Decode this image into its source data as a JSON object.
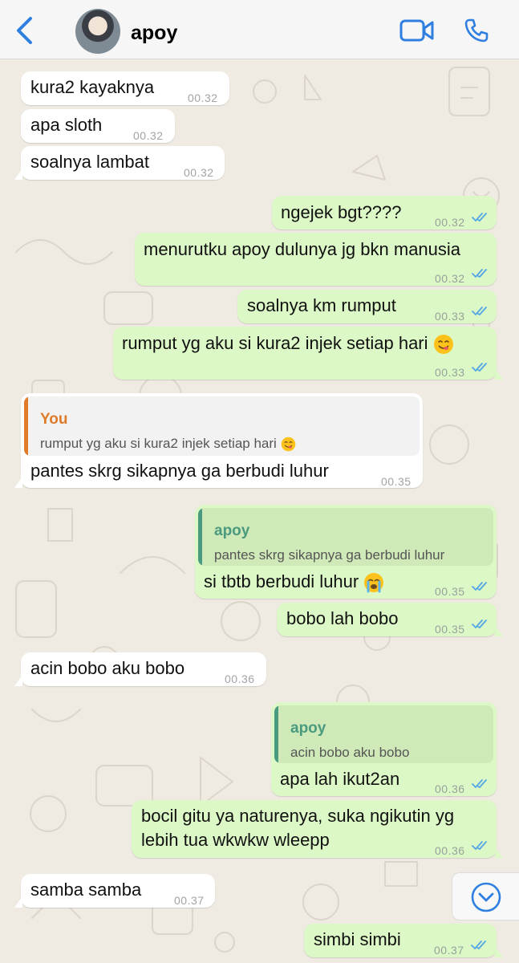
{
  "header": {
    "contact_name": "apoy"
  },
  "messages": [
    {
      "id": "m1",
      "dir": "in",
      "text": "kura2 kayaknya",
      "time": "00.32"
    },
    {
      "id": "m2",
      "dir": "in",
      "text": "apa sloth",
      "time": "00.32"
    },
    {
      "id": "m3",
      "dir": "in",
      "text": "soalnya lambat",
      "time": "00.32"
    },
    {
      "id": "m4",
      "dir": "out",
      "text": "ngejek bgt????",
      "time": "00.32"
    },
    {
      "id": "m5",
      "dir": "out",
      "text": "menurutku apoy dulunya jg bkn manusia",
      "time": "00.32"
    },
    {
      "id": "m6",
      "dir": "out",
      "text": "soalnya km rumput",
      "time": "00.33"
    },
    {
      "id": "m7",
      "dir": "out",
      "text": "rumput yg aku si kura2 injek setiap hari",
      "emoji": "yum",
      "time": "00.33"
    },
    {
      "id": "m8",
      "dir": "in",
      "quote_name": "You",
      "quote_text": "rumput yg aku si kura2 injek setiap hari",
      "quote_emoji": "yum",
      "text": "pantes skrg sikapnya ga berbudi luhur",
      "time": "00.35"
    },
    {
      "id": "m9",
      "dir": "out",
      "quote_name": "apoy",
      "quote_text": "pantes skrg sikapnya ga berbudi luhur",
      "text": "si tbtb berbudi luhur",
      "emoji": "crying",
      "time": "00.35"
    },
    {
      "id": "m10",
      "dir": "out",
      "text": "bobo lah bobo",
      "time": "00.35"
    },
    {
      "id": "m11",
      "dir": "in",
      "text": "acin bobo aku bobo",
      "time": "00.36"
    },
    {
      "id": "m12",
      "dir": "out",
      "quote_name": "apoy",
      "quote_text": "acin bobo aku bobo",
      "text": "apa lah ikut2an",
      "time": "00.36"
    },
    {
      "id": "m13",
      "dir": "out",
      "text_line1": "bocil gitu ya naturenya, suka ngikutin yg",
      "text_line2": "lebih tua wkwkw wleepp",
      "time": "00.36"
    },
    {
      "id": "m14",
      "dir": "in",
      "text": "samba samba",
      "time": "00.37"
    },
    {
      "id": "m15",
      "dir": "out",
      "text": "simbi simbi",
      "time": "00.37"
    }
  ],
  "colors": {
    "accent_blue": "#2f7fe0",
    "tick_blue": "#53a6e6",
    "out_bubble": "#dcf8c6",
    "in_bubble": "#ffffff",
    "quote_you": "#e07b2a",
    "quote_contact": "#4a9a7f"
  },
  "icons": [
    "back-chevron-icon",
    "avatar",
    "video-call-icon",
    "phone-call-icon",
    "double-check-icon",
    "chevron-down-icon"
  ]
}
